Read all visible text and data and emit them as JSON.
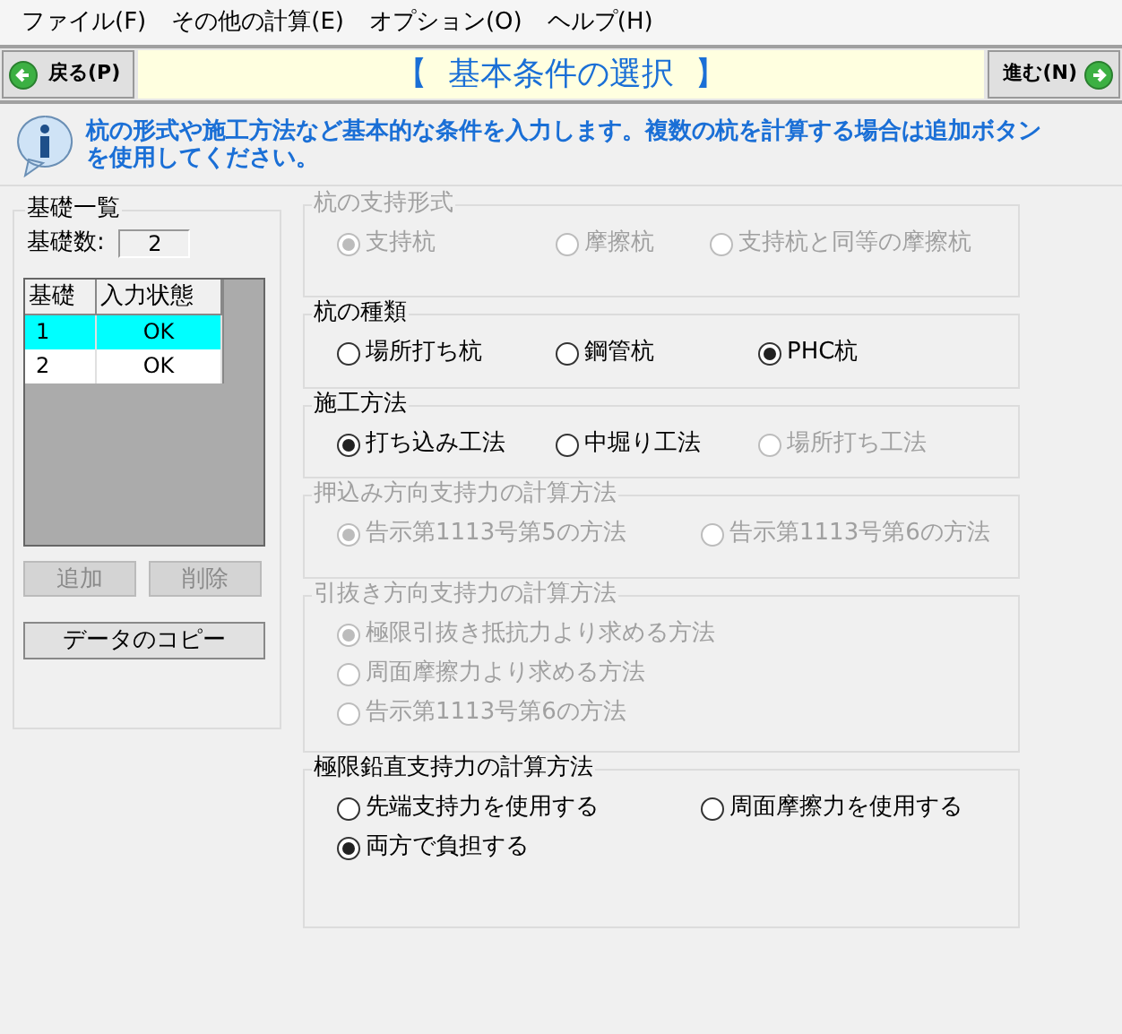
{
  "menu": [
    "ファイル(F)",
    "その他の計算(E)",
    "オプション(O)",
    "ヘルプ(H)"
  ],
  "toolbar": {
    "back": "戻る(P)",
    "title": "【  基本条件の選択  】",
    "next": "進む(N)"
  },
  "info": "杭の形式や施工方法など基本的な条件を入力します。複数の杭を計算する場合は追加ボタンを使用してください。",
  "foundations": {
    "title": "基礎一覧",
    "count_label": "基礎数:",
    "count": "2",
    "columns": [
      "基礎",
      "入力状態"
    ],
    "rows": [
      {
        "cells": [
          "1",
          "OK"
        ],
        "selected": true
      },
      {
        "cells": [
          "2",
          "OK"
        ],
        "selected": false
      }
    ],
    "buttons": [
      {
        "label": "追加",
        "disabled": true
      },
      {
        "label": "削除",
        "disabled": true
      }
    ],
    "copy": "データのコピー"
  },
  "groups": [
    {
      "title": "杭の支持形式",
      "disabled": true,
      "rows": [
        [
          {
            "label": "支持杭",
            "selected": true,
            "disabled": true
          },
          {
            "label": "摩擦杭",
            "selected": false,
            "disabled": true
          },
          {
            "label": "支持杭と同等の摩擦杭",
            "selected": false,
            "disabled": true
          }
        ]
      ]
    },
    {
      "title": "杭の種類",
      "disabled": false,
      "rows": [
        [
          {
            "label": "場所打ち杭",
            "selected": false,
            "disabled": false
          },
          {
            "label": "鋼管杭",
            "selected": false,
            "disabled": false
          },
          {
            "label": "PHC杭",
            "selected": true,
            "disabled": false
          }
        ]
      ]
    },
    {
      "title": "施工方法",
      "disabled": false,
      "rows": [
        [
          {
            "label": "打ち込み工法",
            "selected": true,
            "disabled": false
          },
          {
            "label": "中堀り工法",
            "selected": false,
            "disabled": false
          },
          {
            "label": "場所打ち工法",
            "selected": false,
            "disabled": true
          }
        ]
      ]
    },
    {
      "title": "押込み方向支持力の計算方法",
      "disabled": true,
      "rows": [
        [
          {
            "label": "告示第1113号第5の方法",
            "selected": true,
            "disabled": true
          },
          {
            "label": "告示第1113号第6の方法",
            "selected": false,
            "disabled": true
          }
        ]
      ]
    },
    {
      "title": "引抜き方向支持力の計算方法",
      "disabled": true,
      "rows": [
        [
          {
            "label": "極限引抜き抵抗力より求める方法",
            "selected": true,
            "disabled": true
          }
        ],
        [
          {
            "label": "周面摩擦力より求める方法",
            "selected": false,
            "disabled": true
          }
        ],
        [
          {
            "label": "告示第1113号第6の方法",
            "selected": false,
            "disabled": true
          }
        ]
      ]
    },
    {
      "title": "極限鉛直支持力の計算方法",
      "disabled": false,
      "rows": [
        [
          {
            "label": "先端支持力を使用する",
            "selected": false,
            "disabled": false
          },
          {
            "label": "周面摩擦力を使用する",
            "selected": false,
            "disabled": false
          }
        ],
        [
          {
            "label": "両方で負担する",
            "selected": true,
            "disabled": false
          }
        ]
      ]
    }
  ]
}
